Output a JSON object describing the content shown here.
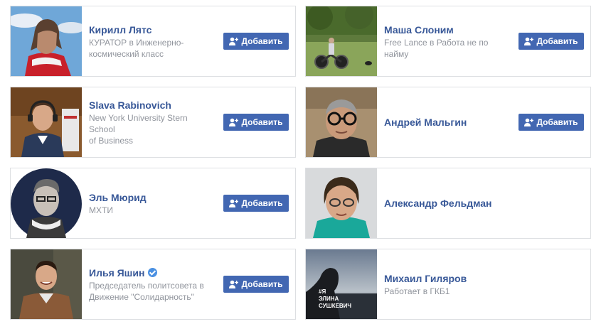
{
  "add_label": "Добавить",
  "colors": {
    "link": "#385898",
    "button": "#4267b2",
    "muted": "#90949c",
    "border": "#dddfe2"
  },
  "people": [
    {
      "name": "Кирилл Лятс",
      "line1": "КУРАТОР в Инженерно-",
      "line2": "космический класс",
      "has_add": true,
      "verified": false
    },
    {
      "name": "Маша Слоним",
      "line1": "Free Lance в Работа не по",
      "line2": "найму",
      "has_add": true,
      "verified": false
    },
    {
      "name": "Slava Rabinovich",
      "line1": "New York University Stern School",
      "line2": "of Business",
      "has_add": true,
      "verified": false
    },
    {
      "name": "Андрей Мальгин",
      "line1": "",
      "line2": "",
      "has_add": true,
      "verified": false
    },
    {
      "name": "Эль Мюрид",
      "line1": "МХТИ",
      "line2": "",
      "has_add": true,
      "verified": false
    },
    {
      "name": "Александр Фельдман",
      "line1": "",
      "line2": "",
      "has_add": false,
      "verified": false
    },
    {
      "name": "Илья Яшин",
      "line1": "Председатель политсовета в",
      "line2": "Движение \"Солидарность\"",
      "has_add": true,
      "verified": true
    },
    {
      "name": "Михаил Гиляров",
      "line1": "Работает в ГКБ1",
      "line2": "",
      "has_add": false,
      "verified": false,
      "photo_text": [
        "#Я",
        "ЭЛИНА",
        "СУШКЕВИЧ"
      ]
    }
  ]
}
